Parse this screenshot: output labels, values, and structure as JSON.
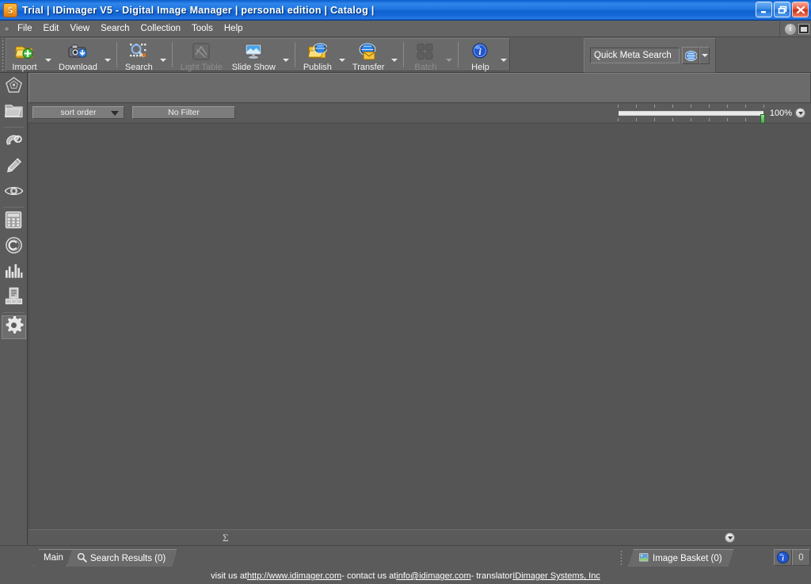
{
  "window": {
    "title": "Trial  |  IDimager V5 - Digital Image Manager  |  personal edition  |  Catalog  |",
    "logo_glyph": "5",
    "minimize_label": "Minimize",
    "maximize_label": "Restore",
    "close_label": "Close"
  },
  "menubar": {
    "items": [
      {
        "label": "File"
      },
      {
        "label": "Edit"
      },
      {
        "label": "View"
      },
      {
        "label": "Search"
      },
      {
        "label": "Collection"
      },
      {
        "label": "Tools"
      },
      {
        "label": "Help"
      }
    ],
    "right_icons": [
      {
        "name": "info-icon",
        "glyph": "i"
      },
      {
        "name": "window-icon",
        "glyph": ""
      }
    ]
  },
  "toolbar": {
    "buttons": [
      {
        "label": "Import",
        "icon": "import-icon",
        "enabled": true,
        "dropdown": true,
        "group": 1
      },
      {
        "label": "Download",
        "icon": "download-icon",
        "enabled": true,
        "dropdown": true,
        "group": 1
      },
      {
        "label": "Search",
        "icon": "search-icon",
        "enabled": true,
        "dropdown": true,
        "group": 2
      },
      {
        "label": "Light Table",
        "icon": "light-table-icon",
        "enabled": false,
        "dropdown": false,
        "group": 3
      },
      {
        "label": "Slide Show",
        "icon": "slide-show-icon",
        "enabled": true,
        "dropdown": true,
        "group": 3
      },
      {
        "label": "Publish",
        "icon": "publish-icon",
        "enabled": true,
        "dropdown": true,
        "group": 4
      },
      {
        "label": "Transfer",
        "icon": "transfer-icon",
        "enabled": true,
        "dropdown": true,
        "group": 4
      },
      {
        "label": "Batch",
        "icon": "batch-icon",
        "enabled": false,
        "dropdown": true,
        "group": 5
      },
      {
        "label": "Help",
        "icon": "help-icon",
        "enabled": true,
        "dropdown": true,
        "group": 6
      }
    ]
  },
  "quick_search": {
    "placeholder": "Quick Meta Search",
    "value": "",
    "button_icon": "globe-icon",
    "dropdown_icon": "chevron-down-icon"
  },
  "sidebar": {
    "items": [
      {
        "name": "sidebar-item-catalog",
        "icon": "pentagon-star-icon"
      },
      {
        "name": "sidebar-item-folders",
        "icon": "folder-icon"
      },
      {
        "name": "sidebar-item-tags",
        "icon": "tag-lasso-icon"
      },
      {
        "name": "sidebar-item-edit",
        "icon": "pencil-icon"
      },
      {
        "name": "sidebar-item-view",
        "icon": "eye-icon"
      },
      {
        "name": "sidebar-item-grid",
        "icon": "calculator-grid-icon"
      },
      {
        "name": "sidebar-item-copyright",
        "icon": "copyright-icon"
      },
      {
        "name": "sidebar-item-statistics",
        "icon": "bar-chart-icon"
      },
      {
        "name": "sidebar-item-documents",
        "icon": "document-stack-icon"
      },
      {
        "name": "sidebar-item-settings",
        "icon": "gear-icon"
      }
    ]
  },
  "filterbar": {
    "sort_order_label": "sort order",
    "filter_label": "No Filter",
    "zoom_value": "100%",
    "zoom_percent": 100,
    "zoom_dropdown_icon": "chevron-down-icon"
  },
  "canvas": {
    "sum_glyph": "Σ",
    "collapse_icon": "chevron-down-icon",
    "empty": true
  },
  "tabs": {
    "left": [
      {
        "label": "Main",
        "icon": null,
        "selected": true
      },
      {
        "label": "Search Results (0)",
        "icon": "search-icon",
        "selected": false
      }
    ],
    "right": [
      {
        "label": "Image Basket (0)",
        "icon": "basket-image-icon",
        "selected": false
      }
    ],
    "status_buttons": [
      {
        "name": "info-status-button",
        "glyph": "i"
      },
      {
        "name": "count-status-button",
        "glyph": "0"
      }
    ]
  },
  "footer": {
    "prefix": "visit us at ",
    "website": "http://www.idimager.com",
    "mid": " - contact us at ",
    "email": "info@idimager.com",
    "mid2": "  - translator ",
    "translator": "IDimager Systems, Inc"
  },
  "colors": {
    "titlebar_blue": "#1f76e0",
    "chrome_gray": "#5d5d5d",
    "canvas_gray": "#555555",
    "panel_gray": "#6a6a6a",
    "text_white": "#ffffff",
    "disabled_gray": "#8d8d8d",
    "accent_green": "#2f9f2f",
    "close_red": "#c82f14"
  }
}
